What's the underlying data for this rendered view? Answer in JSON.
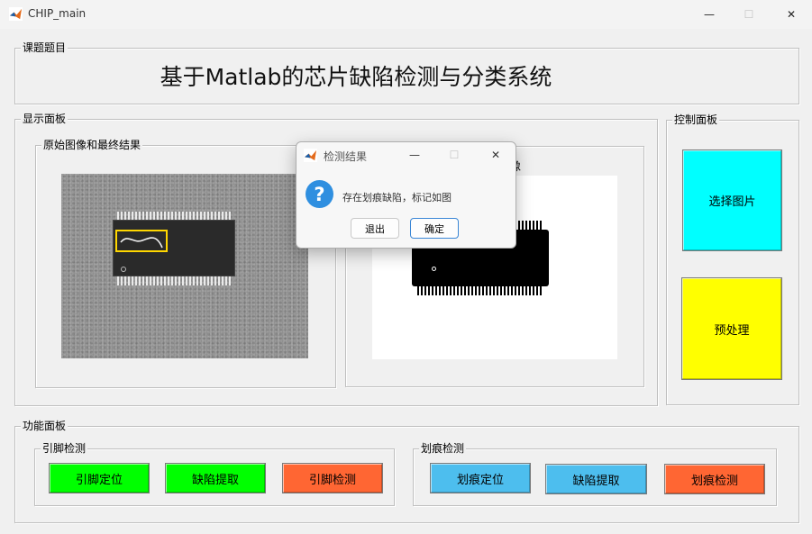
{
  "window": {
    "title": "CHIP_main",
    "controls": [
      "—",
      "☐",
      "✕"
    ]
  },
  "topic_panel": {
    "title": "课题题目",
    "heading": "基于Matlab的芯片缺陷检测与分类系统"
  },
  "display_panel": {
    "title": "显示面板",
    "left_subpanel": {
      "title": "原始图像和最终结果"
    },
    "right_subpanel": {
      "visible_label": "像"
    }
  },
  "control_panel": {
    "title": "控制面板",
    "buttons": [
      {
        "label": "选择图片",
        "color": "#00ffff"
      },
      {
        "label": "预处理",
        "color": "#ffff00"
      }
    ]
  },
  "function_panel": {
    "title": "功能面板",
    "pin_group": {
      "title": "引脚检测",
      "buttons": [
        {
          "label": "引脚定位",
          "color": "#00ff00"
        },
        {
          "label": "缺陷提取",
          "color": "#00ff00"
        },
        {
          "label": "引脚检测",
          "color": "#ff6633"
        }
      ]
    },
    "scratch_group": {
      "title": "划痕检测",
      "buttons": [
        {
          "label": "划痕定位",
          "color": "#4dbeee"
        },
        {
          "label": "缺陷提取",
          "color": "#4dbeee"
        },
        {
          "label": "划痕检测",
          "color": "#ff6633"
        }
      ]
    }
  },
  "dialog": {
    "title": "检测结果",
    "icon": "question-icon",
    "message": "存在划痕缺陷，标记如图",
    "buttons": [
      "退出",
      "确定"
    ]
  },
  "colors": {
    "defect_box": "#ffd700",
    "background": "#f0f0f0",
    "dialog_accent": "#2f8fe0"
  }
}
